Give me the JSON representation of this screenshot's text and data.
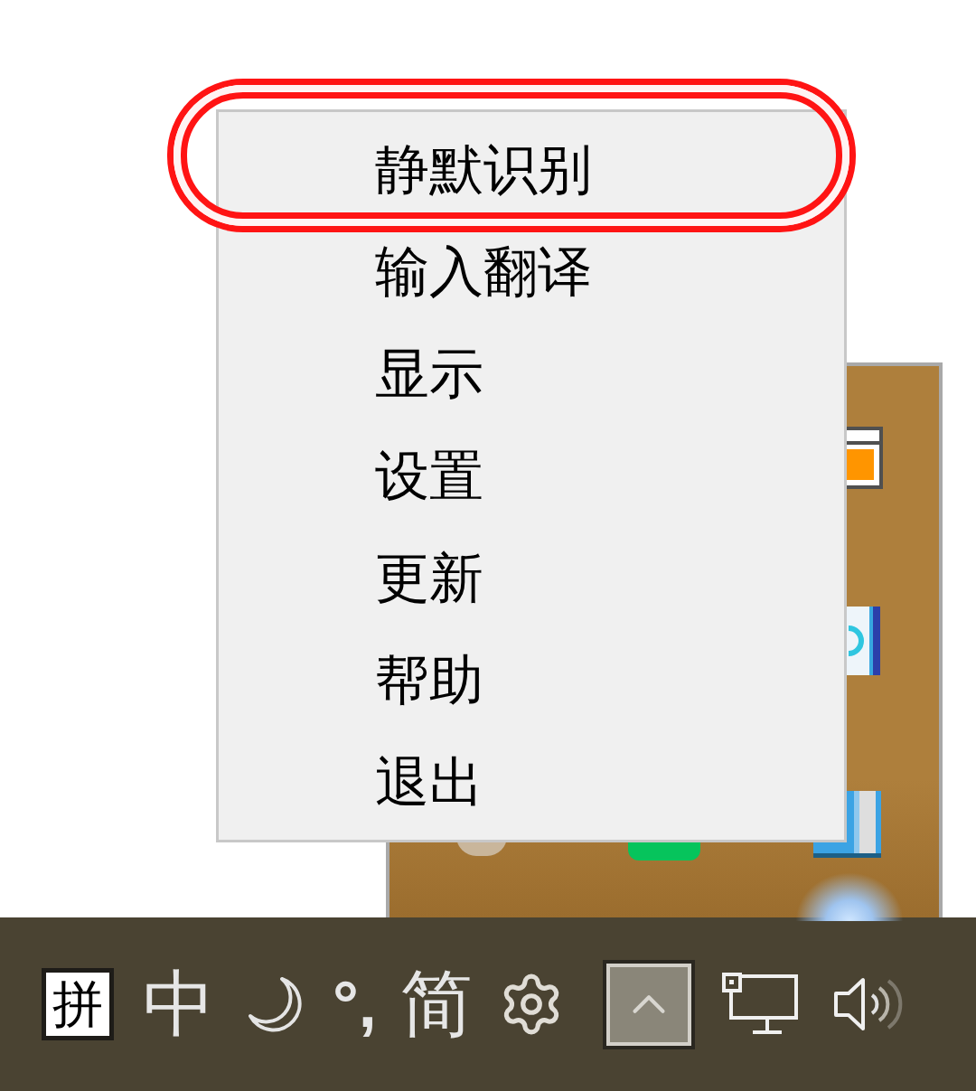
{
  "context_menu": {
    "items": [
      {
        "label": "静默识别",
        "circled": true
      },
      {
        "label": "输入翻译",
        "circled": false
      },
      {
        "label": "显示",
        "circled": false
      },
      {
        "label": "设置",
        "circled": false
      },
      {
        "label": "更新",
        "circled": false
      },
      {
        "label": "帮助",
        "circled": false
      },
      {
        "label": "退出",
        "circled": false
      }
    ]
  },
  "taskbar": {
    "ime_toolbar": {
      "mode": "拼",
      "language": "中",
      "punctuation": "°,",
      "script": "简"
    }
  }
}
